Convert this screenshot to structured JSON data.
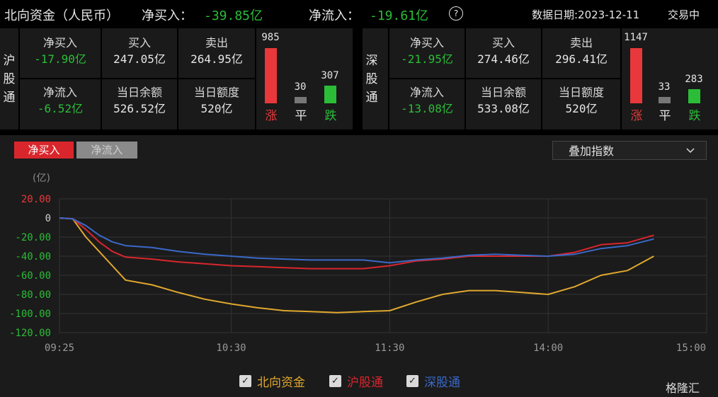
{
  "header": {
    "title": "北向资金（人民币）",
    "net_buy_label": "净买入：",
    "net_buy_value": "-39.85亿",
    "net_inflow_label": "净流入：",
    "net_inflow_value": "-19.61亿",
    "help_icon": "?",
    "date_label": "数据日期:2023-12-11",
    "status": "交易中"
  },
  "sh_panel": {
    "name": [
      "沪",
      "股",
      "通"
    ],
    "net_buy_label": "净买入",
    "net_buy_value": "-17.90亿",
    "buy_label": "买入",
    "buy_value": "247.05亿",
    "sell_label": "卖出",
    "sell_value": "264.95亿",
    "net_inflow_label": "净流入",
    "net_inflow_value": "-6.52亿",
    "balance_label": "当日余额",
    "balance_value": "526.52亿",
    "quota_label": "当日额度",
    "quota_value": "520亿",
    "up_count": "985",
    "flat_count": "30",
    "down_count": "307",
    "up_label": "涨",
    "flat_label": "平",
    "down_label": "跌"
  },
  "sz_panel": {
    "name": [
      "深",
      "股",
      "通"
    ],
    "net_buy_label": "净买入",
    "net_buy_value": "-21.95亿",
    "buy_label": "买入",
    "buy_value": "274.46亿",
    "sell_label": "卖出",
    "sell_value": "296.41亿",
    "net_inflow_label": "净流入",
    "net_inflow_value": "-13.08亿",
    "balance_label": "当日余额",
    "balance_value": "533.08亿",
    "quota_label": "当日额度",
    "quota_value": "520亿",
    "up_count": "1147",
    "flat_count": "33",
    "down_count": "283",
    "up_label": "涨",
    "flat_label": "平",
    "down_label": "跌"
  },
  "tabs": {
    "active": "净买入",
    "inactive": "净流入"
  },
  "overlay_select": {
    "label": "叠加指数",
    "icon": "chevron-down"
  },
  "watermark": "格隆汇",
  "colors": {
    "north": "#e0a82e",
    "sh": "#d9262d",
    "sz": "#3a69c8",
    "up": "#e8383b",
    "down": "#2bbd38"
  },
  "chart_data": {
    "type": "line",
    "unit_label": "(亿)",
    "ylim": [
      -120,
      20
    ],
    "yticks": [
      "20.00",
      "0",
      "-20.00",
      "-40.00",
      "-60.00",
      "-80.00",
      "-100.00",
      "-120.00"
    ],
    "ytick_values": [
      20,
      0,
      -20,
      -40,
      -60,
      -80,
      -100,
      -120
    ],
    "xticks": [
      "09:25",
      "10:30",
      "11:30",
      "14:00",
      "15:00"
    ],
    "grid": true,
    "legend": "bottom-center",
    "x": [
      "09:25",
      "09:30",
      "09:35",
      "09:40",
      "09:45",
      "09:50",
      "10:00",
      "10:10",
      "10:20",
      "10:30",
      "10:40",
      "10:50",
      "11:00",
      "11:10",
      "11:20",
      "11:30",
      "13:10",
      "13:20",
      "13:30",
      "13:40",
      "13:50",
      "14:00",
      "14:10",
      "14:20",
      "14:30",
      "14:40"
    ],
    "series": [
      {
        "name": "北向资金",
        "color": "#e0a82e",
        "values": [
          0,
          -1,
          -20,
          -35,
          -50,
          -65,
          -70,
          -78,
          -85,
          -90,
          -94,
          -97,
          -98,
          -99,
          -98,
          -97,
          -88,
          -80,
          -76,
          -76,
          -78,
          -80,
          -72,
          -60,
          -55,
          -40
        ]
      },
      {
        "name": "沪股通",
        "color": "#d9262d",
        "values": [
          0,
          -1,
          -12,
          -25,
          -35,
          -41,
          -43,
          -46,
          -48,
          -50,
          -51,
          -52,
          -53,
          -53,
          -53,
          -50,
          -45,
          -43,
          -40,
          -40,
          -40,
          -40,
          -36,
          -28,
          -26,
          -18
        ]
      },
      {
        "name": "深股通",
        "color": "#3a69c8",
        "values": [
          0,
          -1,
          -8,
          -18,
          -25,
          -29,
          -31,
          -35,
          -38,
          -40,
          -42,
          -43,
          -44,
          -44,
          -44,
          -47,
          -44,
          -42,
          -39,
          -38,
          -39,
          -40,
          -38,
          -32,
          -29,
          -22
        ]
      }
    ]
  }
}
